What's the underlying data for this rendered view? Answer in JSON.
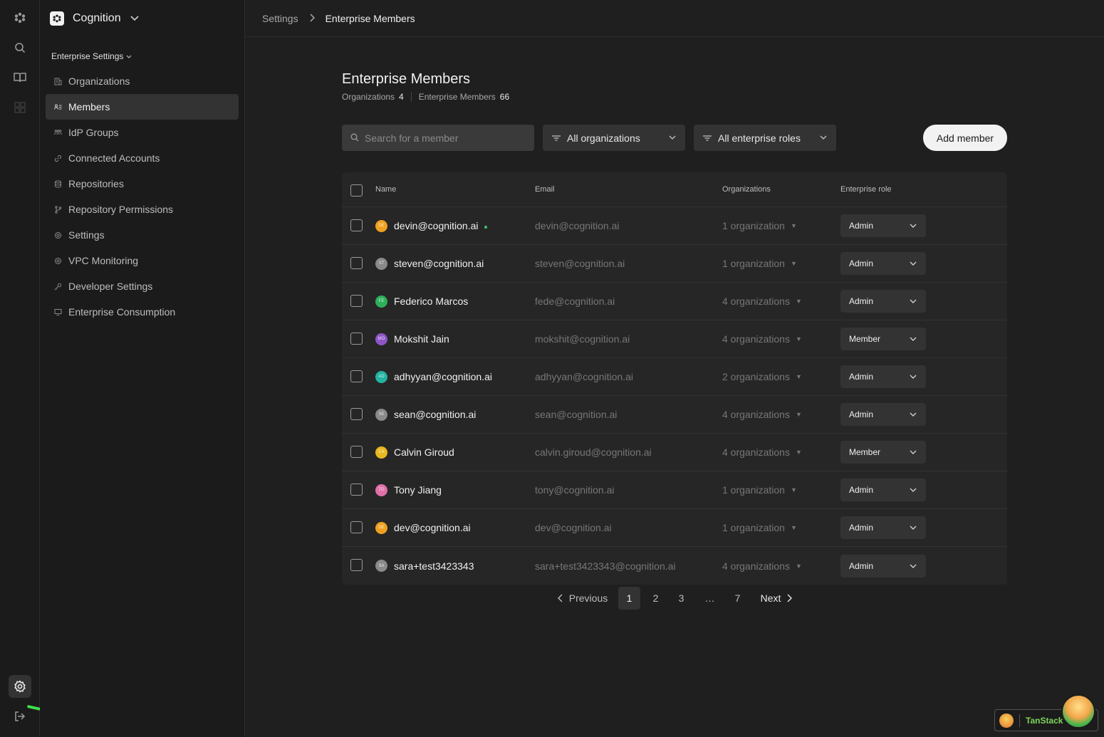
{
  "rail": {
    "icons": [
      "logo-icon",
      "search-icon",
      "book-icon",
      "grid-icon"
    ],
    "bottom_icons": [
      "settings-icon",
      "logout-icon"
    ]
  },
  "sidebar": {
    "org_name": "Cognition",
    "section_label": "Enterprise Settings",
    "items": [
      {
        "label": "Organizations",
        "icon": "building-icon"
      },
      {
        "label": "Members",
        "icon": "users-icon",
        "active": true
      },
      {
        "label": "IdP Groups",
        "icon": "group-icon"
      },
      {
        "label": "Connected Accounts",
        "icon": "link-icon"
      },
      {
        "label": "Repositories",
        "icon": "database-icon"
      },
      {
        "label": "Repository Permissions",
        "icon": "branch-icon"
      },
      {
        "label": "Settings",
        "icon": "gear-icon"
      },
      {
        "label": "VPC Monitoring",
        "icon": "gear-icon"
      },
      {
        "label": "Developer Settings",
        "icon": "key-icon"
      },
      {
        "label": "Enterprise Consumption",
        "icon": "monitor-icon"
      }
    ]
  },
  "breadcrumb": {
    "parent": "Settings",
    "current": "Enterprise Members"
  },
  "main": {
    "title": "Enterprise Members",
    "stats": {
      "orgs_label": "Organizations",
      "orgs_value": "4",
      "members_label": "Enterprise Members",
      "members_value": "66"
    },
    "search_placeholder": "Search for a member",
    "filter_orgs": "All organizations",
    "filter_roles": "All enterprise roles",
    "add_button": "Add member"
  },
  "table": {
    "headers": {
      "name": "Name",
      "email": "Email",
      "orgs": "Organizations",
      "role": "Enterprise role"
    },
    "rows": [
      {
        "initials": "DE",
        "name": "devin@cognition.ai",
        "email": "devin@cognition.ai",
        "orgs": "1 organization",
        "role": "Admin",
        "avatar_color": "#f0a020",
        "online": true
      },
      {
        "initials": "ST",
        "name": "steven@cognition.ai",
        "email": "steven@cognition.ai",
        "orgs": "1 organization",
        "role": "Admin",
        "avatar_color": "#8a8a8a"
      },
      {
        "initials": "FE",
        "name": "Federico Marcos",
        "email": "fede@cognition.ai",
        "orgs": "4 organizations",
        "role": "Admin",
        "avatar_color": "#2fae5a"
      },
      {
        "initials": "MO",
        "name": "Mokshit Jain",
        "email": "mokshit@cognition.ai",
        "orgs": "4 organizations",
        "role": "Member",
        "avatar_color": "#8e55c8"
      },
      {
        "initials": "AD",
        "name": "adhyyan@cognition.ai",
        "email": "adhyyan@cognition.ai",
        "orgs": "2 organizations",
        "role": "Admin",
        "avatar_color": "#22b3a0"
      },
      {
        "initials": "SE",
        "name": "sean@cognition.ai",
        "email": "sean@cognition.ai",
        "orgs": "4 organizations",
        "role": "Admin",
        "avatar_color": "#8a8a8a"
      },
      {
        "initials": "CA",
        "name": "Calvin Giroud",
        "email": "calvin.giroud@cognition.ai",
        "orgs": "4 organizations",
        "role": "Member",
        "avatar_color": "#e8b820"
      },
      {
        "initials": "TO",
        "name": "Tony Jiang",
        "email": "tony@cognition.ai",
        "orgs": "1 organization",
        "role": "Admin",
        "avatar_color": "#e070a8"
      },
      {
        "initials": "DE",
        "name": "dev@cognition.ai",
        "email": "dev@cognition.ai",
        "orgs": "1 organization",
        "role": "Admin",
        "avatar_color": "#f0a020"
      },
      {
        "initials": "SA",
        "name": "sara+test3423343",
        "email": "sara+test3423343@cognition.ai",
        "orgs": "4 organizations",
        "role": "Admin",
        "avatar_color": "#8a8a8a"
      }
    ]
  },
  "pagination": {
    "previous": "Previous",
    "pages": [
      "1",
      "2",
      "3",
      "…",
      "7"
    ],
    "current": "1",
    "next": "Next"
  },
  "devtools": {
    "label": "TanStack"
  }
}
